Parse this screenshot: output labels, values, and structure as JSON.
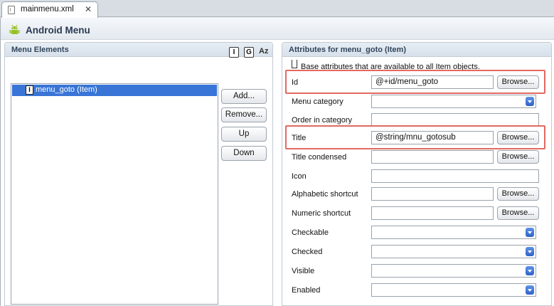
{
  "tab": {
    "title": "mainmenu.xml",
    "close_glyph": "✕",
    "file_icon": "xml-file-icon"
  },
  "header": {
    "title": "Android Menu",
    "icon": "android-icon"
  },
  "left": {
    "title": "Menu Elements",
    "toolbar": {
      "item_glyph": "I",
      "group_glyph": "G",
      "sort_label": "Az"
    },
    "tree_items": [
      {
        "glyph": "I",
        "label": "menu_goto (Item)",
        "selected": true
      }
    ],
    "buttons": {
      "add": "Add...",
      "remove": "Remove...",
      "up": "Up",
      "down": "Down"
    }
  },
  "right": {
    "title": "Attributes for menu_goto (Item)",
    "description": "Base attributes that are available to all Item objects.",
    "browse_label": "Browse...",
    "fields": {
      "id": {
        "label": "Id",
        "value": "@+id/menu_goto"
      },
      "menu_category": {
        "label": "Menu category",
        "value": ""
      },
      "order_in_category": {
        "label": "Order in category",
        "value": ""
      },
      "title": {
        "label": "Title",
        "value": "@string/mnu_gotosub"
      },
      "title_condensed": {
        "label": "Title condensed",
        "value": ""
      },
      "icon": {
        "label": "Icon",
        "value": ""
      },
      "alphabetic_shortcut": {
        "label": "Alphabetic shortcut",
        "value": ""
      },
      "numeric_shortcut": {
        "label": "Numeric shortcut",
        "value": ""
      },
      "checkable": {
        "label": "Checkable",
        "value": ""
      },
      "checked": {
        "label": "Checked",
        "value": ""
      },
      "visible": {
        "label": "Visible",
        "value": ""
      },
      "enabled": {
        "label": "Enabled",
        "value": ""
      }
    }
  },
  "colors": {
    "selection": "#3875d7",
    "highlight": "#e26a62",
    "header_text": "#2b3a52",
    "android_green": "#97c024"
  }
}
